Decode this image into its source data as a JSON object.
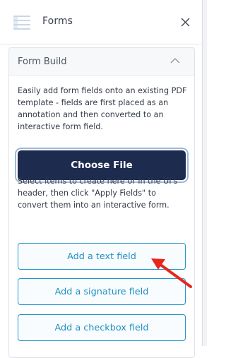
{
  "header": {
    "title": "Forms",
    "menu_icon": "hamburger-list-icon",
    "close_icon": "close-icon"
  },
  "section": {
    "title": "Form Build",
    "toggle_icon": "chevron-up-icon",
    "description": "Easily add form fields onto an existing PDF template - fields are first placed as an annotation and then converted to an interactive form field.",
    "choose_file_label": "Choose File",
    "instructions": "Select items to create here or in the UI's header, then click \"Apply Fields\" to convert them into an interactive form.",
    "field_buttons": [
      {
        "label": "Add a text field"
      },
      {
        "label": "Add a signature field"
      },
      {
        "label": "Add a checkbox field"
      }
    ]
  },
  "colors": {
    "primary_dark": "#1d2b4f",
    "accent_blue": "#1f8fbf",
    "annotation_arrow": "#e8261c"
  }
}
